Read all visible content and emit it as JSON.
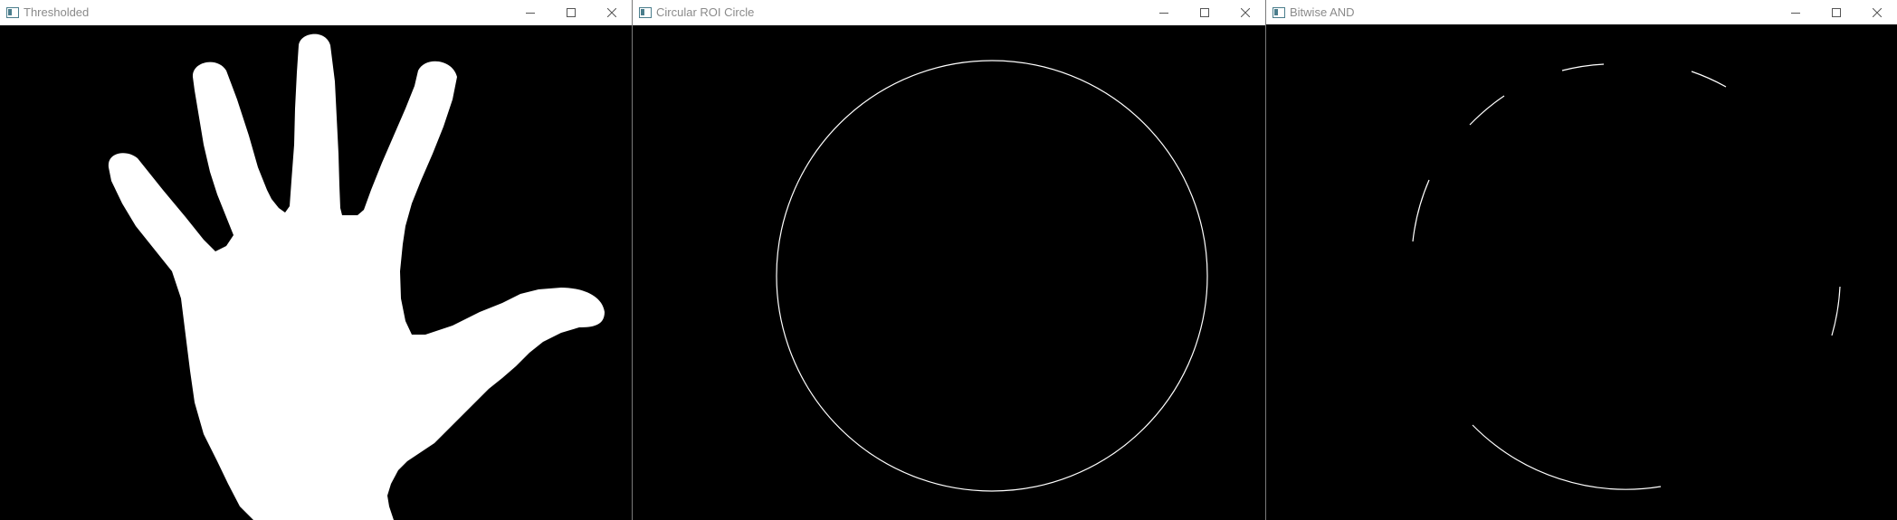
{
  "windows": [
    {
      "title": "Thresholded",
      "icon": "app-window-icon"
    },
    {
      "title": "Circular ROI Circle",
      "icon": "app-window-icon"
    },
    {
      "title": "Bitwise AND",
      "icon": "app-window-icon"
    }
  ],
  "controls": [
    "minimize-icon",
    "maximize-icon",
    "close-icon"
  ],
  "colors": {
    "titlebar_bg": "#ffffff",
    "title_text": "#8a8a8a",
    "image_bg": "#000000",
    "foreground": "#ffffff"
  }
}
